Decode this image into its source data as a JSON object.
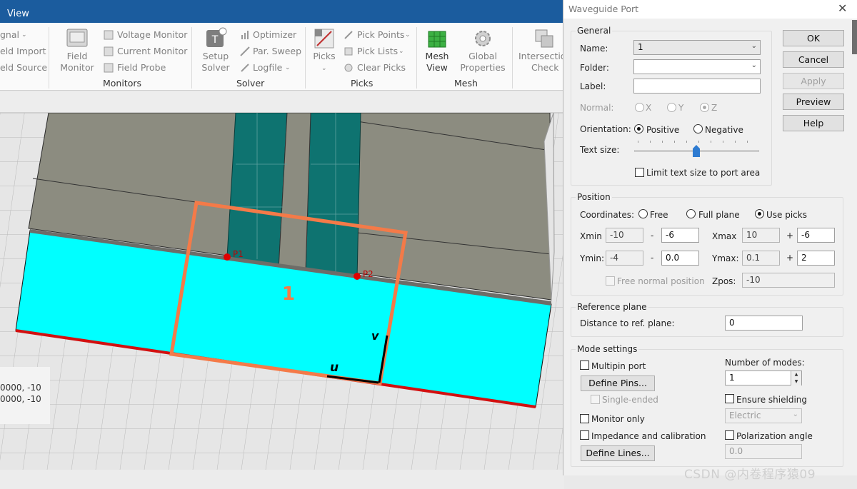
{
  "titlebar": {
    "view_tab": "View"
  },
  "ribbon": {
    "cut_left": {
      "signal": "gnal",
      "field_import": "eld Import",
      "field_source": "eld Source"
    },
    "field_monitor": {
      "line1": "Field",
      "line2": "Monitor"
    },
    "monitors": {
      "voltage": "Voltage Monitor",
      "current": "Current Monitor",
      "probe": "Field Probe",
      "group": "Monitors"
    },
    "setup_solver": {
      "line1": "Setup",
      "line2": "Solver"
    },
    "solver": {
      "optimizer": "Optimizer",
      "par_sweep": "Par. Sweep",
      "logfile": "Logfile",
      "group": "Solver"
    },
    "picks_big": "Picks",
    "picks": {
      "pick_points": "Pick Points",
      "pick_lists": "Pick Lists",
      "clear_picks": "Clear Picks",
      "group": "Picks"
    },
    "mesh_view": {
      "line1": "Mesh",
      "line2": "View"
    },
    "global_props": {
      "line1": "Global",
      "line2": "Properties"
    },
    "mesh_group": "Mesh",
    "intersection": {
      "line1": "Intersectio",
      "line2": "Check"
    }
  },
  "viewport": {
    "pick1": "P1",
    "pick2": "P2",
    "port_number": "1",
    "axis_u": "u",
    "axis_v": "v",
    "coords": {
      "line1": "0000, -10",
      "line2": "0000, -10"
    },
    "colors": {
      "substrate": "#00ffff",
      "metal": "#8c8c80",
      "trace": "#0e7370",
      "port_outline": "#f47a48",
      "pick": "#e00000",
      "ground": "#d21010"
    }
  },
  "dialog": {
    "title": "Waveguide Port",
    "buttons": {
      "ok": "OK",
      "cancel": "Cancel",
      "apply": "Apply",
      "preview": "Preview",
      "help": "Help"
    },
    "general": {
      "title": "General",
      "name_label": "Name:",
      "name_value": "1",
      "folder_label": "Folder:",
      "folder_value": "",
      "label_label": "Label:",
      "label_value": "",
      "normal_label": "Normal:",
      "normal_options": [
        "X",
        "Y",
        "Z"
      ],
      "normal_selected": "Z",
      "orientation_label": "Orientation:",
      "orientation_options": [
        "Positive",
        "Negative"
      ],
      "orientation_selected": "Positive",
      "text_size_label": "Text size:",
      "text_size_level": 0.5,
      "limit_text": "Limit text size to port area"
    },
    "position": {
      "title": "Position",
      "coordinates_label": "Coordinates:",
      "coord_options": [
        "Free",
        "Full plane",
        "Use picks"
      ],
      "coord_selected": "Use picks",
      "xmin_label": "Xmin",
      "xmin_value": "-10",
      "xmin_offset": "-6",
      "xmax_label": "Xmax",
      "xmax_value": "10",
      "xmax_offset": "-6",
      "ymin_label": "Ymin:",
      "ymin_value": "-4",
      "ymin_offset": "0.0",
      "ymax_label": "Ymax:",
      "ymax_value": "0.1",
      "ymax_offset": "2",
      "minus": "-",
      "plus": "+",
      "free_normal": "Free normal position",
      "zpos_label": "Zpos:",
      "zpos_value": "-10"
    },
    "reference": {
      "title": "Reference plane",
      "distance_label": "Distance to ref. plane:",
      "distance_value": "0"
    },
    "mode": {
      "title": "Mode settings",
      "multipin": "Multipin port",
      "define_pins": "Define Pins...",
      "single_ended": "Single-ended",
      "monitor_only": "Monitor only",
      "impedance": "Impedance and calibration",
      "define_lines": "Define Lines...",
      "num_modes_label": "Number of modes:",
      "num_modes_value": "1",
      "ensure_shielding": "Ensure shielding",
      "electric": "Electric",
      "polarization": "Polarization angle",
      "polarization_value": "0.0"
    }
  },
  "watermark": "CSDN @内卷程序猿09"
}
